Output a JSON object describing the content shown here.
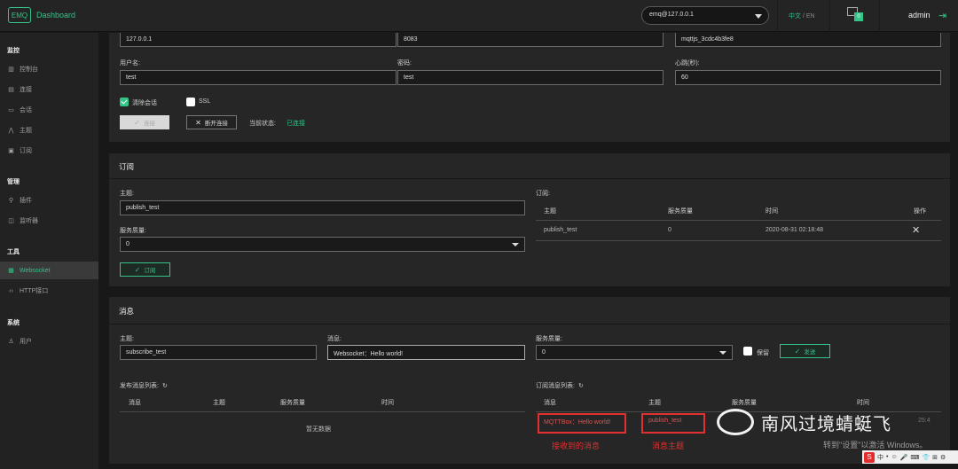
{
  "header": {
    "logo_mark": "EMQ",
    "app_name": "Dashboard",
    "node": "emq@127.0.0.1",
    "lang_active": "中文",
    "lang_sep": " / ",
    "lang_other": "EN",
    "alarm_count": "0",
    "user": "admin"
  },
  "sidebar": {
    "groups": [
      "监控",
      "管理",
      "工具",
      "系统"
    ],
    "items": [
      {
        "label": "控制台",
        "icon": "chart-icon"
      },
      {
        "label": "连接",
        "icon": "list-icon"
      },
      {
        "label": "会话",
        "icon": "chat-icon"
      },
      {
        "label": "主题",
        "icon": "topic-icon"
      },
      {
        "label": "订阅",
        "icon": "subscribe-icon"
      },
      {
        "label": "插件",
        "icon": "plugin-icon"
      },
      {
        "label": "监听器",
        "icon": "listener-icon"
      },
      {
        "label": "Websocket",
        "icon": "websocket-icon"
      },
      {
        "label": "HTTP接口",
        "icon": "code-icon"
      },
      {
        "label": "用户",
        "icon": "user-icon"
      }
    ],
    "active": "Websocket"
  },
  "connection": {
    "host": "127.0.0.1",
    "port": "8083",
    "client_id": "mqttjs_3cdc4b3fe8",
    "username_label": "用户名:",
    "username": "test",
    "password_label": "密码:",
    "password": "test",
    "keepalive_label": "心跳(秒):",
    "keepalive": "60",
    "clean_session_label": "清除会话",
    "clean_session": true,
    "ssl_label": "SSL",
    "ssl": false,
    "connect_label": "连接",
    "disconnect_label": "断开连接",
    "status_label": "当前状态:",
    "status": "已连接"
  },
  "subscribe": {
    "title": "订阅",
    "topic_label": "主题:",
    "topic": "publish_test",
    "qos_label": "服务质量:",
    "qos": "0",
    "button": "订阅",
    "list_title": "订阅:",
    "columns": [
      "主题",
      "服务质量",
      "时间",
      "操作"
    ],
    "rows": [
      {
        "topic": "publish_test",
        "qos": "0",
        "time": "2020-08-31 02:18:48"
      }
    ]
  },
  "message": {
    "title": "消息",
    "topic_label": "主题:",
    "topic": "subscribe_test",
    "message_label": "消息:",
    "message": "Websocket：Hello world!",
    "qos_label": "服务质量:",
    "qos": "0",
    "retain_label": "保留",
    "retain": false,
    "send_label": "发送",
    "published_title": "发布消息列表:",
    "published_columns": [
      "消息",
      "主题",
      "服务质量",
      "时间"
    ],
    "published_empty": "暂无数据",
    "received_title": "订阅消息列表:",
    "received_columns": [
      "消息",
      "主题",
      "服务质量",
      "时间"
    ],
    "received_rows": [
      {
        "message": "MQTTBox：Hello world!",
        "topic": "publish_test"
      }
    ],
    "received_time_partial": "25:4"
  },
  "annotations": {
    "received_msg": "接收到的消息",
    "msg_topic": "消息主题"
  },
  "watermark": {
    "text": "南风过境蜻蜓飞",
    "windows_activate": "转到\"设置\"以激活 Windows。"
  },
  "tray": {
    "ime": "S",
    "items": [
      "中",
      "•",
      "☺",
      "🎤",
      "⌨",
      "👕",
      "⊞",
      "⚙"
    ]
  }
}
